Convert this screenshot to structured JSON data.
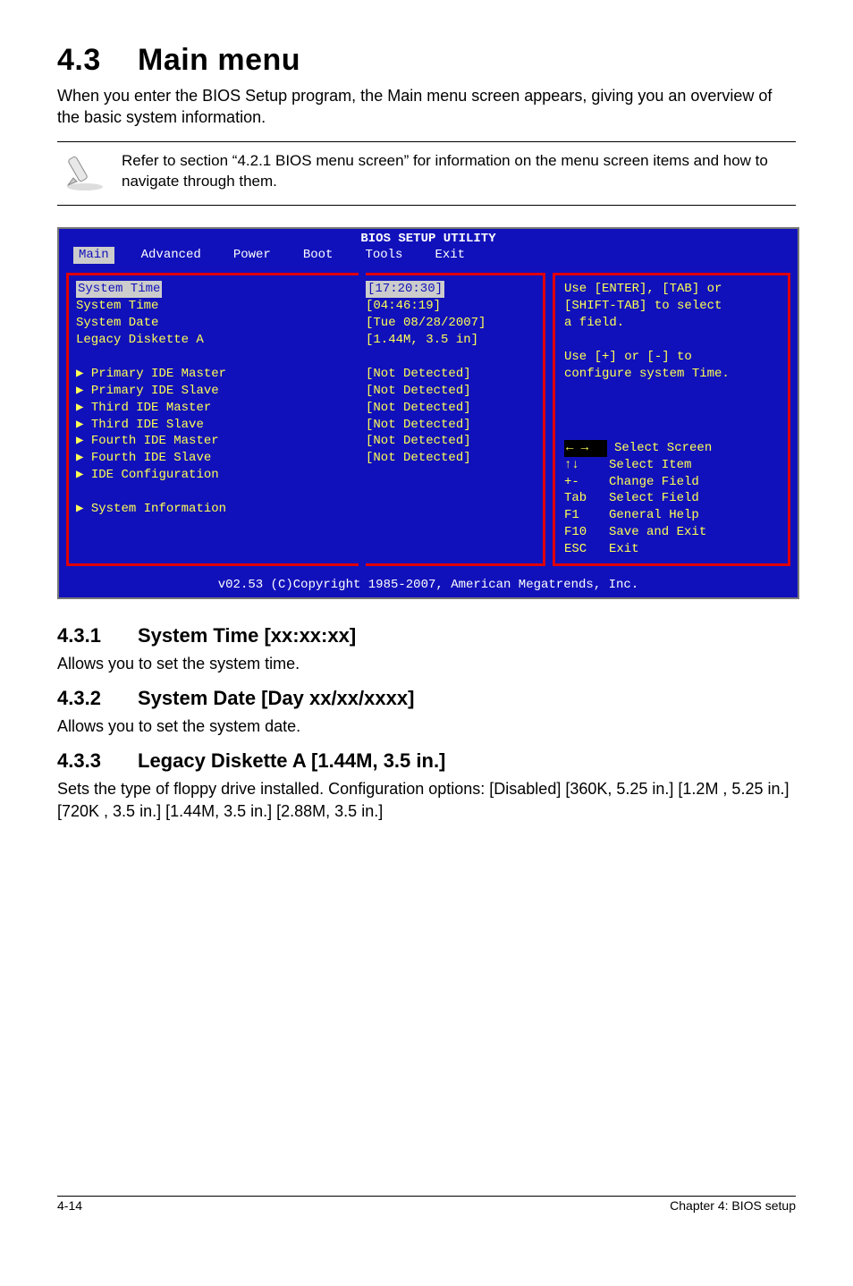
{
  "section": {
    "number": "4.3",
    "title": "Main menu"
  },
  "intro": "When you enter the BIOS Setup program, the Main menu screen appears, giving you an overview of the basic system information.",
  "note": "Refer to section “4.2.1  BIOS menu screen” for information on the menu screen items and how to navigate through them.",
  "bios": {
    "title": "BIOS SETUP UTILITY",
    "tabs": [
      "Main",
      "Advanced",
      "Power",
      "Boot",
      "Tools",
      "Exit"
    ],
    "active_tab": "Main",
    "left": {
      "items": [
        {
          "label": "System Time",
          "value": "[17:20:30]",
          "selected": true
        },
        {
          "label": "System Time",
          "value": "[04:46:19]"
        },
        {
          "label": "System Date",
          "value": "[Tue 08/28/2007]"
        },
        {
          "label": "Legacy Diskette A",
          "value": "[1.44M, 3.5 in]"
        }
      ],
      "spacer": "",
      "detects": [
        {
          "label": "Primary IDE Master",
          "value": "[Not Detected]"
        },
        {
          "label": "Primary IDE Slave",
          "value": "[Not Detected]"
        },
        {
          "label": "Third IDE Master",
          "value": "[Not Detected]"
        },
        {
          "label": "Third IDE Slave",
          "value": "[Not Detected]"
        },
        {
          "label": "Fourth IDE Master",
          "value": "[Not Detected]"
        },
        {
          "label": "Fourth IDE Slave",
          "value": "[Not Detected]"
        }
      ],
      "extra": [
        "IDE Configuration",
        "",
        "System Information"
      ]
    },
    "help_top": [
      "Use [ENTER], [TAB] or",
      "[SHIFT-TAB] to select",
      "a field.",
      "",
      "Use [+] or [-] to",
      "configure system Time."
    ],
    "help_keys": [
      {
        "key": "← →",
        "text": "Select Screen",
        "black": true
      },
      {
        "key": "↑↓",
        "text": "Select Item"
      },
      {
        "key": "+-",
        "text": "Change Field"
      },
      {
        "key": "Tab",
        "text": "Select Field"
      },
      {
        "key": "F1",
        "text": "General Help"
      },
      {
        "key": "F10",
        "text": "Save and Exit"
      },
      {
        "key": "ESC",
        "text": "Exit"
      }
    ],
    "footer": "v02.53 (C)Copyright 1985-2007, American Megatrends, Inc."
  },
  "subsections": [
    {
      "num": "4.3.1",
      "title": "System Time [xx:xx:xx]",
      "body": "Allows you to set the system time."
    },
    {
      "num": "4.3.2",
      "title": "System Date [Day xx/xx/xxxx]",
      "body": "Allows you to set the system date."
    },
    {
      "num": "4.3.3",
      "title": "Legacy Diskette A [1.44M, 3.5 in.]",
      "body": "Sets the type of floppy drive installed. Configuration options: [Disabled] [360K, 5.25 in.] [1.2M , 5.25 in.] [720K , 3.5 in.] [1.44M, 3.5 in.] [2.88M, 3.5 in.]"
    }
  ],
  "footer": {
    "left": "4-14",
    "right": "Chapter 4: BIOS setup"
  }
}
